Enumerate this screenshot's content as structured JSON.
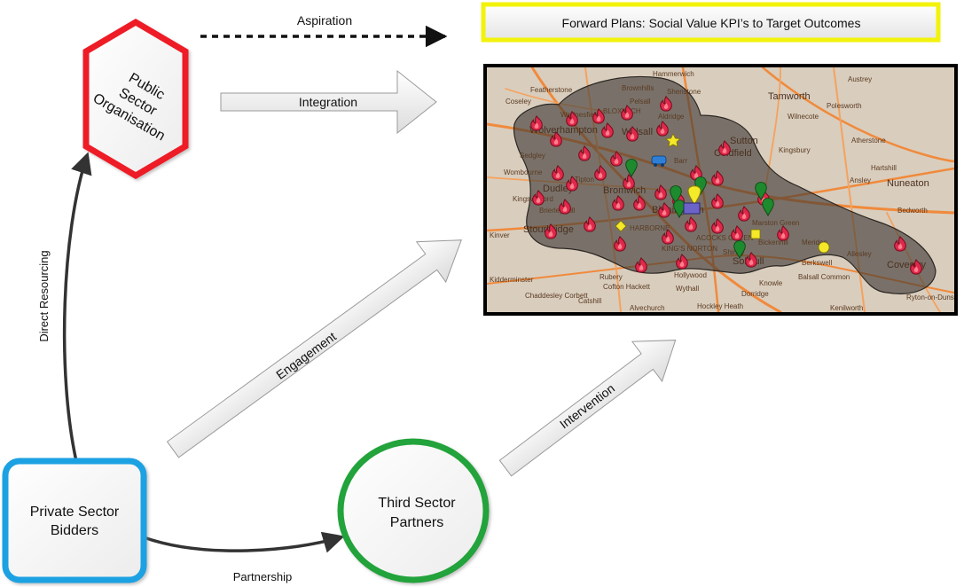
{
  "nodes": {
    "public": "Public Sector Organisation",
    "public_lines": [
      "Public",
      "Sector",
      "Organisation"
    ],
    "private_lines": [
      "Private Sector",
      "Bidders"
    ],
    "third_lines": [
      "Third Sector",
      "Partners"
    ]
  },
  "edges": {
    "aspiration": "Aspiration",
    "integration": "Integration",
    "direct_resourcing": "Direct Resourcing",
    "engagement": "Engagement",
    "intervention": "Intervention",
    "partnership": "Partnership"
  },
  "banner": {
    "title": "Forward Plans: Social Value KPI’s to Target Outcomes"
  },
  "colors": {
    "public_border": "#ee1c25",
    "private_border": "#1ba1e2",
    "third_border": "#22a33a",
    "banner_border": "#f2f20c",
    "map_frame": "#000000"
  },
  "map": {
    "places": [
      "Hammerwich",
      "Austrey",
      "Featherstone",
      "Brownhills",
      "Shenstone",
      "Tamworth",
      "Polesworth",
      "Wilnecote",
      "Coseley",
      "Pelsall",
      "Aldridge",
      "Atherstone",
      "Wolverhampton",
      "Walsall",
      "Sutton",
      "Coldfield",
      "Kingsbury",
      "Hartshill",
      "Wombourne",
      "Tipton",
      "Dudley",
      "Bromwich",
      "Nuneaton",
      "Kingswinford",
      "Ansley",
      "Brierley Hill",
      "Birmingham",
      "Bedworth",
      "Kinver",
      "Stourbridge",
      "HARBORNE",
      "Marston Green",
      "ACOCKS GREEN",
      "Bickenhill",
      "Meriden",
      "Allesley",
      "KING'S NORTON",
      "Solihull",
      "Berkswell",
      "Coventry",
      "Kidderminster",
      "Rubery",
      "Shirley",
      "Knowle",
      "Balsall Common",
      "Chaddesley Corbett",
      "Cofton Hackett",
      "Hollywood",
      "Dorridge",
      "Catshill",
      "Alvechurch",
      "Wythall",
      "Hockley Heath",
      "Kenilworth",
      "Ryton-on-Dunsmore",
      "BLOXWICH",
      "Wednesfield",
      "Barr",
      "Sedgley"
    ]
  }
}
